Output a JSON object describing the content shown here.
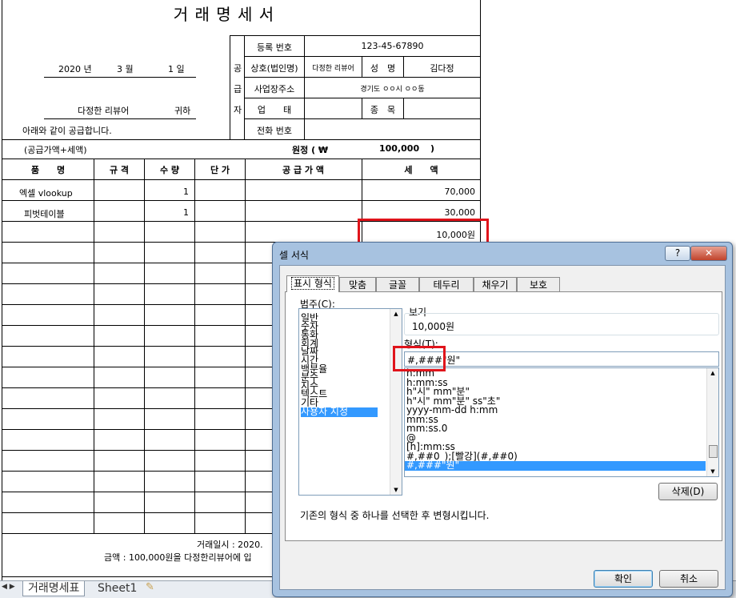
{
  "sheet": {
    "title": "거 래 명 세 서",
    "date_year": "2020 년",
    "date_month": "3 월",
    "date_day": "1 일",
    "recipient": "다정한 리뷰어",
    "honorific": "귀하",
    "statement": "아래와 같이 공급합니다.",
    "supplier_side": [
      "공",
      "급",
      "자"
    ],
    "reg_label": "등록 번호",
    "reg_value": "123-45-67890",
    "company_label": "상호(법인명)",
    "company_value": "다정한 리뷰어",
    "name_label": "성　명",
    "name_value": "김다정",
    "address_label": "사업장주소",
    "address_value": "경기도 ㅇㅇ시 ㅇㅇ동",
    "business_label": "업　　태",
    "item_label": "종　목",
    "phone_label": "전화 번호",
    "sum_note": "(공급가액+세액)",
    "sum_label": "원정 ( ₩",
    "sum_value": "100,000",
    "sum_close": ")",
    "headers": [
      "품　　명",
      "규 격",
      "수 량",
      "단 가",
      "공 급 가 액",
      "세　　액"
    ],
    "rows": [
      {
        "name": "엑셀 vlookup",
        "qty": "1",
        "tax": "70,000"
      },
      {
        "name": "피벗테이블",
        "qty": "1",
        "tax": "30,000"
      },
      {
        "name": "",
        "qty": "",
        "tax": "10,000원"
      }
    ],
    "footer_line1": "거래일시 : 2020.",
    "footer_line2": "금액 : 100,000원을 다정한리뷰어에 입"
  },
  "sheet_tabs": [
    "거래명세표",
    "Sheet1"
  ],
  "dialog": {
    "title": "셀 서식",
    "help": "?",
    "close": "✕",
    "tabs": [
      "표시 형식",
      "맞춤",
      "글꼴",
      "테두리",
      "채우기",
      "보호"
    ],
    "category_label": "범주(C):",
    "categories": [
      "일반",
      "숫자",
      "통화",
      "회계",
      "날짜",
      "시간",
      "백분율",
      "분수",
      "지수",
      "텍스트",
      "기타",
      "사용자 지정"
    ],
    "preview_label": "보기",
    "preview_value": "10,000원",
    "format_label": "형식(T):",
    "format_value": "#,###\"원\"",
    "formats": [
      "h:mm",
      "h:mm:ss",
      "h\"시\" mm\"분\"",
      "h\"시\" mm\"분\" ss\"초\"",
      "yyyy-mm-dd h:mm",
      "mm:ss",
      "mm:ss.0",
      "@",
      "[h]:mm:ss",
      "#,##0_);[빨강](#,##0)",
      "#,###\"원\""
    ],
    "delete_button": "삭제(D)",
    "hint": "기존의 형식 중 하나를 선택한 후 변형시킵니다.",
    "ok": "확인",
    "cancel": "취소"
  },
  "colors": {
    "highlight": "#e0141b",
    "selection": "#3399ff"
  }
}
